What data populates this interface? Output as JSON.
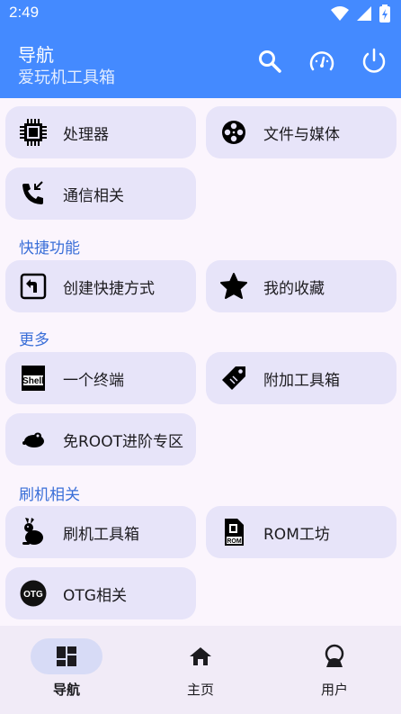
{
  "status_bar": {
    "time": "2:49",
    "icons": [
      "wifi-icon",
      "signal-icon",
      "battery-icon"
    ]
  },
  "app_bar": {
    "title": "导航",
    "subtitle": "爱玩机工具箱",
    "actions": [
      "search-icon",
      "speedometer-icon",
      "power-icon"
    ],
    "color": "#448aff"
  },
  "main": {
    "cards_top": [
      {
        "label": "处理器",
        "icon": "cpu-icon"
      },
      {
        "label": "文件与媒体",
        "icon": "film-reel-icon"
      },
      {
        "label": "通信相关",
        "icon": "phone-icon"
      }
    ],
    "sections": [
      {
        "title": "快捷功能",
        "items": [
          {
            "label": "创建快捷方式",
            "icon": "shortcut-icon"
          },
          {
            "label": "我的收藏",
            "icon": "star-icon"
          }
        ]
      },
      {
        "title": "更多",
        "items": [
          {
            "label": "一个终端",
            "icon": "shell-icon"
          },
          {
            "label": "附加工具箱",
            "icon": "tag-icon"
          },
          {
            "label": "免ROOT进阶专区",
            "icon": "mouse-icon"
          }
        ]
      },
      {
        "title": "刷机相关",
        "items": [
          {
            "label": "刷机工具箱",
            "icon": "rabbit-icon"
          },
          {
            "label": "ROM工坊",
            "icon": "rom-file-icon"
          },
          {
            "label": "OTG相关",
            "icon": "otg-icon"
          }
        ]
      }
    ]
  },
  "otg_badge": "OTG",
  "shell_badge": "Shell",
  "rom_badge": "ROM",
  "bottom_nav": [
    {
      "label": "导航",
      "icon": "dashboard-icon",
      "active": true
    },
    {
      "label": "主页",
      "icon": "home-icon",
      "active": false
    },
    {
      "label": "用户",
      "icon": "user-icon",
      "active": false
    }
  ],
  "colors": {
    "card": "#e7e4f9",
    "section_title": "#3a6fd8",
    "background": "#fbf5fd",
    "nav_pill": "#d7dbf6"
  }
}
